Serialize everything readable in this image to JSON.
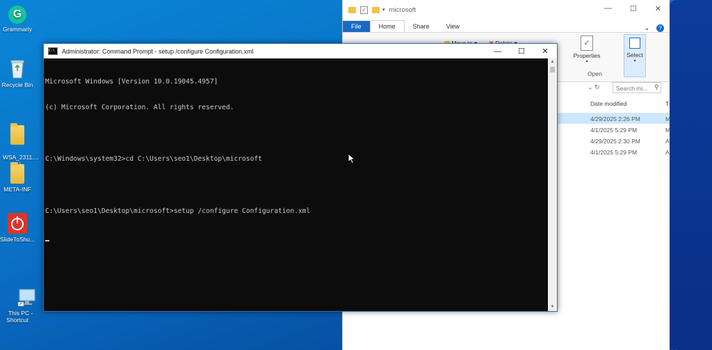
{
  "desktop": {
    "icons": [
      {
        "label": "Grammarly",
        "icon": "grammarly-icon"
      },
      {
        "label": "Recycle Bin",
        "icon": "recycle-bin-icon"
      },
      {
        "label": "WSA_2311....\n(1)",
        "icon": "folder-icon"
      },
      {
        "label": "META-INF",
        "icon": "folder-icon"
      },
      {
        "label": "SlideToShu...",
        "icon": "power-icon"
      },
      {
        "label": "This PC -\nShortcut",
        "icon": "computer-icon"
      }
    ]
  },
  "explorer": {
    "title": "microsoft",
    "tabs": [
      "File",
      "Home",
      "Share",
      "View"
    ],
    "ribbon": {
      "move_to": "Move to",
      "delete": "Delete",
      "properties": "Properties",
      "open_group": "Open",
      "select": "Select"
    },
    "search_placeholder": "Search mi...",
    "column_date": "Date modified",
    "column_type_abbrev": "T",
    "rows": [
      {
        "date": "4/29/2025 2:26 PM",
        "type": "M",
        "selected": true,
        "name_fragment": ""
      },
      {
        "date": "4/1/2025 5:29 PM",
        "type": "M",
        "selected": false,
        "name_fragment": ""
      },
      {
        "date": "4/29/2025 2:30 PM",
        "type": "A",
        "selected": false,
        "name_fragment": "56"
      },
      {
        "date": "4/1/2025 5:29 PM",
        "type": "A",
        "selected": false,
        "name_fragment": ""
      }
    ]
  },
  "cmd": {
    "title": "Administrator: Command Prompt - setup  /configure Configuration.xml",
    "lines": [
      "Microsoft Windows [Version 10.0.19045.4957]",
      "(c) Microsoft Corporation. All rights reserved.",
      "",
      "C:\\Windows\\system32>cd C:\\Users\\seo1\\Desktop\\microsoft",
      "",
      "C:\\Users\\seo1\\Desktop\\microsoft>setup /configure Configuration.xml"
    ],
    "minimize": "—",
    "maximize": "☐",
    "close": "✕"
  }
}
